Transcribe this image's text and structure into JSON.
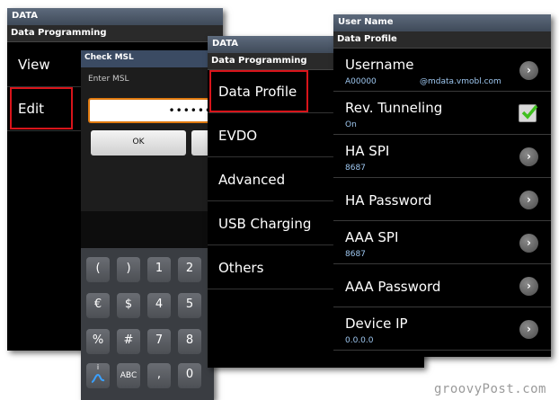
{
  "screen1": {
    "status": "DATA",
    "title": "Data Programming",
    "items": [
      {
        "label": "View"
      },
      {
        "label": "Edit"
      }
    ]
  },
  "dialog": {
    "title": "Check MSL",
    "prompt": "Enter MSL",
    "input_value": "••••••",
    "ok_label": "OK"
  },
  "keyboard": {
    "rows": [
      [
        "(",
        ")",
        "1",
        "2"
      ],
      [
        "€",
        "$",
        "4",
        "5"
      ],
      [
        "%",
        "#",
        "7",
        "8"
      ],
      [
        "i",
        "ABC",
        ",",
        "0"
      ]
    ]
  },
  "screen3": {
    "status": "DATA",
    "title": "Data Programming",
    "items": [
      {
        "label": "Data Profile"
      },
      {
        "label": "EVDO"
      },
      {
        "label": "Advanced"
      },
      {
        "label": "USB Charging"
      },
      {
        "label": "Others"
      }
    ]
  },
  "screen4": {
    "status": "User Name",
    "title": "Data Profile",
    "rows": [
      {
        "title": "Username",
        "sub": "A00000",
        "sub2": "@mdata.vmobl.com",
        "control": "chevron"
      },
      {
        "title": "Rev. Tunneling",
        "sub": "On",
        "control": "checkbox"
      },
      {
        "title": "HA SPI",
        "sub": "8687",
        "control": "chevron"
      },
      {
        "title": "HA Password",
        "sub": "",
        "control": "chevron"
      },
      {
        "title": "AAA SPI",
        "sub": "8687",
        "control": "chevron"
      },
      {
        "title": "AAA Password",
        "sub": "",
        "control": "chevron"
      },
      {
        "title": "Device IP",
        "sub": "0.0.0.0",
        "control": "chevron"
      }
    ]
  },
  "watermark": "groovyPost.com",
  "colors": {
    "highlight": "#d8141a",
    "accent_input": "#e07a10",
    "subtext": "#9ec7f0"
  }
}
